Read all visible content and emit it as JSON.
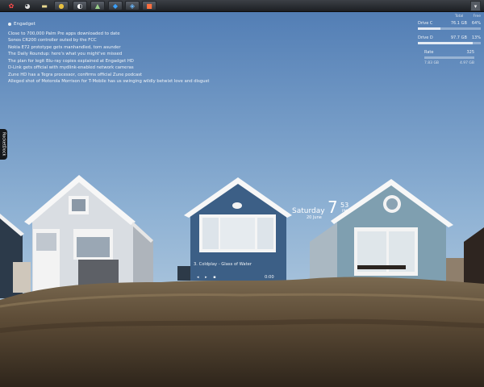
{
  "taskbar": {
    "icons": [
      {
        "name": "gear-icon",
        "glyph": "✿",
        "color": "#ff4a4a"
      },
      {
        "name": "chat-icon",
        "glyph": "◕",
        "color": "#dddddd"
      },
      {
        "name": "folder-icon",
        "glyph": "▬",
        "color": "#e8d890"
      },
      {
        "name": "chrome-icon",
        "glyph": "●",
        "color": "#e8c040"
      },
      {
        "name": "media-icon",
        "glyph": "◐",
        "color": "#ffffff"
      },
      {
        "name": "photo-icon",
        "glyph": "▲",
        "color": "#9ad08a"
      },
      {
        "name": "app-icon",
        "glyph": "◆",
        "color": "#3aa0ff"
      },
      {
        "name": "network-icon",
        "glyph": "◈",
        "color": "#6ab8ff"
      },
      {
        "name": "office-icon",
        "glyph": "■",
        "color": "#ff7040"
      }
    ],
    "corner_glyph": "▾"
  },
  "feed": {
    "title": "Engadget",
    "items": [
      "Close to 700,000 Palm Pre apps downloaded to date",
      "Sonos CR200 controller outed by the FCC",
      "Nokia E72 prototype gets manhandled, torn asunder",
      "The Daily Roundup: here's what you might've missed",
      "The plan for legit Blu-ray copies explained at Engadget HD",
      "D-Link gets official with mydlink-enabled network cameras",
      "Zune HD has a Tegra processor, confirms official Zune podcast",
      "Alleged shot of Motorola Morrison for T-Mobile has us swinging wildly betwixt love and disgust"
    ]
  },
  "drives": {
    "header_total": "Total",
    "header_free": "Free",
    "list": [
      {
        "label": "Drive C",
        "total": "76.1 GB",
        "free": "64%",
        "fill": 0.36
      },
      {
        "label": "Drive D",
        "total": "97.7 GB",
        "free": "13%",
        "fill": 0.87
      }
    ],
    "rate_label": "Rate",
    "rate_value": "325",
    "rate_left": "7.83 GB",
    "rate_right": "4.97 GB"
  },
  "sidetab": {
    "label": "RocketDock"
  },
  "clock": {
    "day": "Saturday",
    "date": "20 June",
    "hour": "7",
    "minute": "53",
    "ampm": "PM"
  },
  "media": {
    "track": "3. Coldplay - Glass of Water",
    "controls": "◂ ▸ ▪",
    "time": "0:00"
  },
  "scene_colors": {
    "sky_top": "#5a84b9",
    "sky_bottom": "#b4cde0",
    "grass": "#6b5a44"
  }
}
